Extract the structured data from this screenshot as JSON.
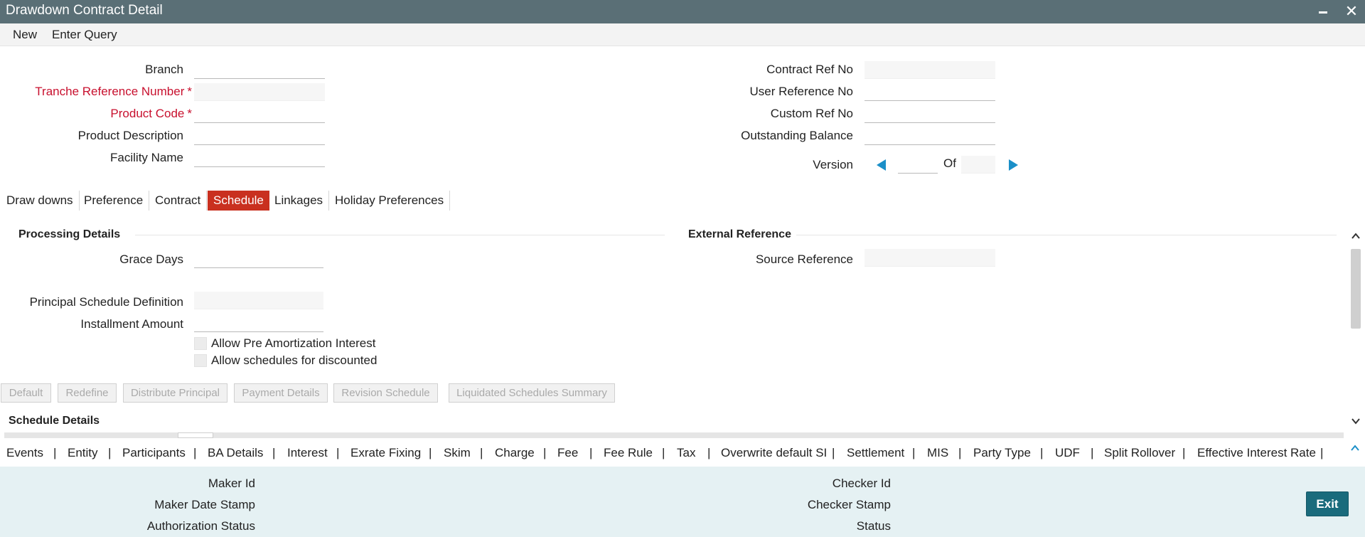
{
  "window": {
    "title": "Drawdown Contract Detail"
  },
  "toolbar": {
    "new_label": "New",
    "enter_query_label": "Enter Query"
  },
  "header_left": {
    "branch_label": "Branch",
    "tranche_label": "Tranche Reference Number",
    "product_code_label": "Product Code",
    "product_description_label": "Product Description",
    "facility_name_label": "Facility Name",
    "required_mark": "*",
    "branch_value": "",
    "tranche_value": "",
    "product_code_value": "",
    "product_description_value": "",
    "facility_name_value": ""
  },
  "header_right": {
    "contract_ref_label": "Contract Ref No",
    "user_ref_label": "User Reference No",
    "custom_ref_label": "Custom Ref No",
    "outstanding_label": "Outstanding Balance",
    "version_label": "Version",
    "of_label": "Of",
    "contract_ref_value": "",
    "user_ref_value": "",
    "custom_ref_value": "",
    "outstanding_value": "",
    "version_value": "",
    "version_total": ""
  },
  "tabs": [
    {
      "label": "Draw downs"
    },
    {
      "label": "Preference"
    },
    {
      "label": "Contract"
    },
    {
      "label": "Schedule"
    },
    {
      "label": "Linkages"
    },
    {
      "label": "Holiday Preferences"
    }
  ],
  "active_tab": "Schedule",
  "processing": {
    "title": "Processing Details",
    "grace_days_label": "Grace Days",
    "grace_days_value": "",
    "principal_schedule_label": "Principal Schedule Definition",
    "principal_schedule_value": "",
    "installment_amount_label": "Installment Amount",
    "installment_amount_value": "",
    "allow_pre_amortization_label": "Allow Pre Amortization Interest",
    "allow_pre_amortization_checked": false,
    "allow_schedules_discounted_label": "Allow schedules for discounted",
    "allow_schedules_discounted_checked": false
  },
  "external": {
    "title": "External Reference",
    "source_reference_label": "Source Reference",
    "source_reference_value": ""
  },
  "action_buttons": {
    "default": "Default",
    "redefine": "Redefine",
    "distribute_principal": "Distribute Principal",
    "payment_details": "Payment Details",
    "revision_schedule": "Revision Schedule",
    "liquidated_schedules_summary": "Liquidated Schedules Summary"
  },
  "schedule_details": {
    "title": "Schedule Details"
  },
  "bottom_links": [
    "Events",
    "Entity",
    "Participants",
    "BA Details",
    "Interest",
    "Exrate Fixing",
    "Skim",
    "Charge",
    "Fee",
    "Fee Rule",
    "Tax",
    "Overwrite default SI",
    "Settlement",
    "MIS",
    "Party Type",
    "UDF",
    "Split Rollover",
    "Effective Interest Rate"
  ],
  "link_separator": "|",
  "footer": {
    "maker_id_label": "Maker Id",
    "maker_date_stamp_label": "Maker Date Stamp",
    "authorization_status_label": "Authorization Status",
    "checker_id_label": "Checker Id",
    "checker_stamp_label": "Checker Stamp",
    "status_label": "Status",
    "exit_label": "Exit"
  },
  "colors": {
    "titlebar": "#5a6f76",
    "required": "#c8102e",
    "active_tab": "#c9301f",
    "nav_arrow": "#1b8fc8",
    "footer_bg": "#e5f1f3",
    "exit_button": "#1a6b7c"
  },
  "icons": {
    "minimize": "minimize-icon",
    "close": "close-icon",
    "prev": "triangle-left-icon",
    "next": "triangle-right-icon",
    "scroll_up": "chevron-up-icon",
    "scroll_down": "chevron-down-icon",
    "collapse": "chevron-up-icon"
  }
}
